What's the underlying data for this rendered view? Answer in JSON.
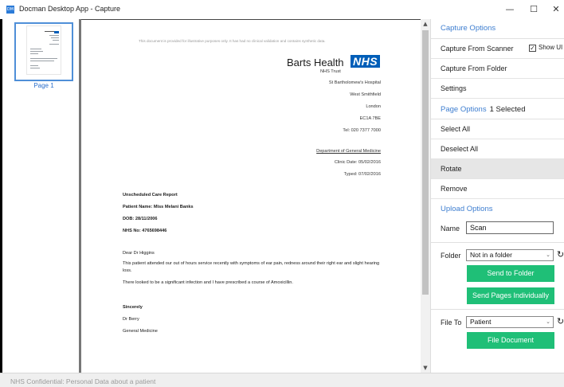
{
  "window": {
    "app_icon": "docman-icon",
    "title": "Docman Desktop App - Capture",
    "minimize": "—",
    "maximize": "☐",
    "close": "✕"
  },
  "thumbnails": {
    "items": [
      {
        "label": "Page 1"
      }
    ]
  },
  "document": {
    "disclaimer": "This document is provided for illustrative purposes only. It has had no clinical validation and contains synthetic data.",
    "logo_name": "Barts Health",
    "logo_badge": "NHS",
    "logo_trust": "NHS Trust",
    "address": [
      "St Bartholomew's Hospital",
      "West Smithfield",
      "London",
      "EC1A 7BE",
      "Tel: 020 7377 7000"
    ],
    "department": "Department of General Medicine",
    "clinic_date": "Clinic Date: 05/02/2016",
    "typed_date": "Typed: 07/02/2016",
    "report_title": "Unscheduled Care Report",
    "patient_name": "Patient Name: Miss Melani Banks",
    "dob": "DOB: 28/11/2006",
    "nhs_no": "NHS No: 4765698446",
    "salutation": "Dear Dr Higgins",
    "paragraph1": "This patient attended our out of hours service recently with symptoms of ear pain, redness around their right ear and slight hearing loss.",
    "paragraph2": "There looked to be a significant infection and I have prescribed a course of Amoxicillin.",
    "signoff": "Sincerely",
    "signer": "Dr Berry",
    "signer_dept": "General Medicine"
  },
  "scroll": {
    "up": "▲",
    "down": "▼"
  },
  "panel": {
    "capture_options": "Capture Options",
    "capture_from_scanner": "Capture From Scanner",
    "show_ui": "Show UI",
    "show_ui_checked": true,
    "show_ui_check": "✓",
    "capture_from_folder": "Capture From Folder",
    "settings": "Settings",
    "page_options": "Page Options",
    "selected_count": "1 Selected",
    "select_all": "Select All",
    "deselect_all": "Deselect All",
    "rotate": "Rotate",
    "remove": "Remove",
    "upload_options": "Upload Options",
    "name_label": "Name",
    "name_value": "Scan",
    "folder_label": "Folder",
    "folder_value": "Not in a folder",
    "send_to_folder": "Send to Folder",
    "send_pages_individually": "Send Pages Individually",
    "file_to_label": "File To",
    "file_to_value": "Patient",
    "file_document": "File Document",
    "chevron": "⌄",
    "refresh": "↻"
  },
  "status": {
    "text": "NHS Confidential: Personal Data about a patient"
  },
  "colors": {
    "accent_blue": "#3e7ed0",
    "nhs_blue": "#005eb8",
    "button_green": "#1fbf77"
  }
}
